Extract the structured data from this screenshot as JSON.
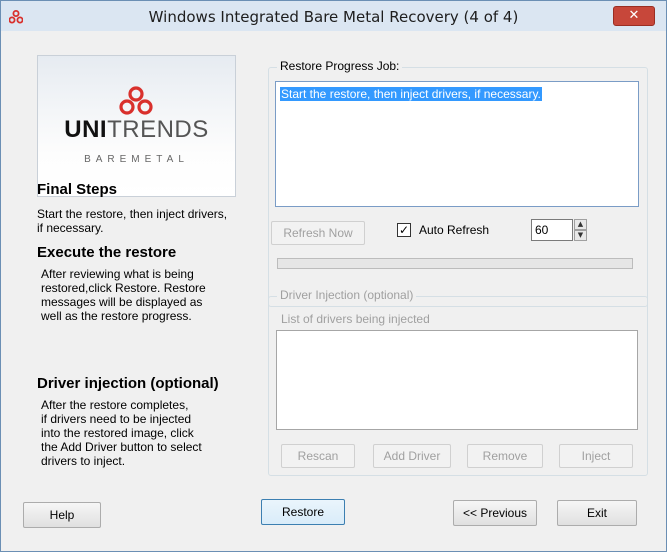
{
  "window": {
    "title": "Windows Integrated Bare Metal Recovery (4 of 4)",
    "close_glyph": "✕",
    "icon": "unitrends-dots-icon",
    "colors": {
      "brand_red": "#d9302c",
      "selection": "#3399ff",
      "title_bar": "#dbe6f2",
      "close": "#c7473a"
    }
  },
  "logo": {
    "brand_bold": "UNI",
    "brand_light": "TRENDS",
    "sub": "BAREMETAL"
  },
  "left": {
    "final_title": "Final Steps",
    "final_text_lines": [
      "Start the restore, then inject drivers,",
      "if necessary."
    ],
    "execute_title": "Execute the restore",
    "execute_lines": [
      "After reviewing what is being",
      "restored,click Restore. Restore",
      "messages  will be displayed as",
      "well as the restore progress."
    ],
    "driver_title": "Driver injection (optional)",
    "driver_lines": [
      "After the restore completes,",
      "if drivers need to be injected",
      "into the restored image, click",
      "the Add Driver button to select",
      "drivers to inject."
    ]
  },
  "restore_group": {
    "label": "Restore Progress Job:",
    "text": "Start the restore, then inject drivers, if necessary.",
    "refresh_button": "Refresh Now",
    "auto_refresh_label": "Auto Refresh",
    "auto_refresh_checked": true,
    "check_glyph": "✓",
    "interval": "60",
    "progress_percent": 0
  },
  "driver_group": {
    "label": "Driver Injection (optional)",
    "list_label": "List of drivers being injected",
    "buttons": {
      "rescan": "Rescan",
      "add": "Add Driver",
      "remove": "Remove",
      "inject": "Inject"
    }
  },
  "footer": {
    "help": "Help",
    "restore": "Restore",
    "previous": "<< Previous",
    "exit": "Exit"
  }
}
